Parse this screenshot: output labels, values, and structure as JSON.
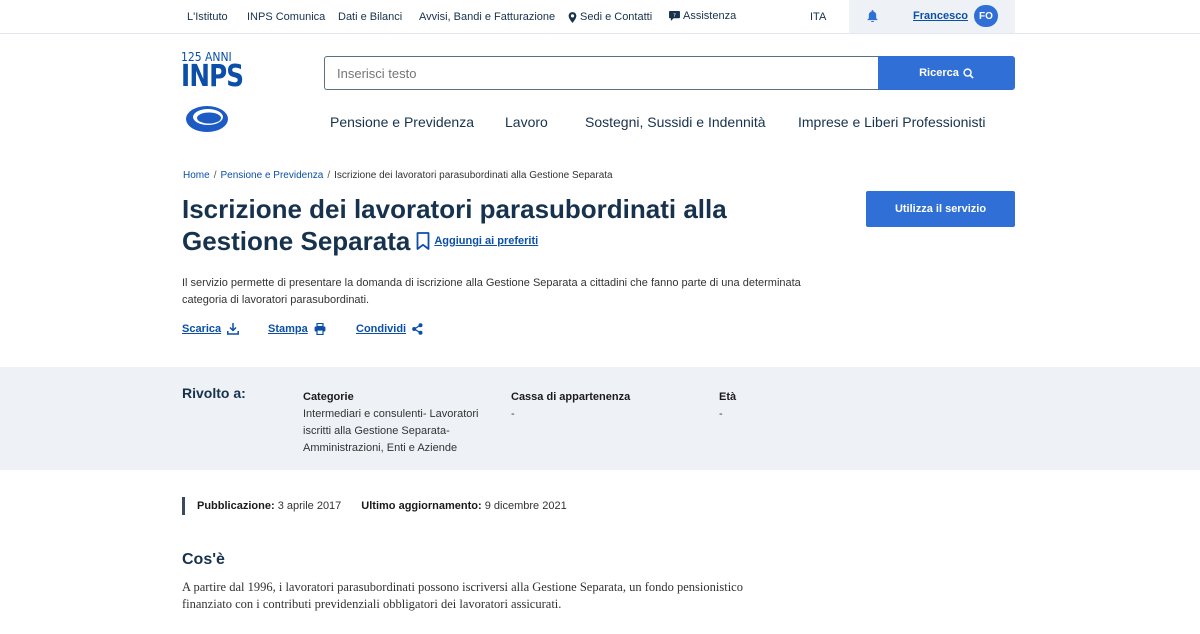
{
  "topbar": {
    "links": [
      "L'Istituto",
      "INPS Comunica",
      "Dati e Bilanci",
      "Avvisi, Bandi e Fatturazione"
    ],
    "sedi": "Sedi e Contatti",
    "assistenza": "Assistenza",
    "language": "ITA",
    "user_name": "Francesco",
    "user_initials": "FO"
  },
  "logo": {
    "top": "125 ANNI",
    "main": "INPS"
  },
  "search": {
    "placeholder": "Inserisci testo",
    "button": "Ricerca"
  },
  "mainnav": [
    "Pensione e Previdenza",
    "Lavoro",
    "Sostegni, Sussidi e Indennità",
    "Imprese e Liberi Professionisti"
  ],
  "breadcrumb": {
    "home": "Home",
    "section": "Pensione e Previdenza",
    "current": "Iscrizione dei lavoratori parasubordinati alla Gestione Separata"
  },
  "page": {
    "title_line1": "Iscrizione dei lavoratori parasubordinati alla",
    "title_line2": "Gestione Separata",
    "favorite": "Aggiungi ai preferiti",
    "use_service": "Utilizza il servizio",
    "description": "Il servizio permette di presentare la domanda di iscrizione alla Gestione Separata a cittadini che fanno parte di una determinata categoria di lavoratori parasubordinati."
  },
  "actions": {
    "download": "Scarica",
    "print": "Stampa",
    "share": "Condividi"
  },
  "rivolto": {
    "label": "Rivolto a:",
    "categorie_head": "Categorie",
    "categorie_value": "Intermediari e consulenti- Lavoratori iscritti alla Gestione Separata- Amministrazioni, Enti e Aziende",
    "cassa_head": "Cassa di appartenenza",
    "cassa_value": "-",
    "eta_head": "Età",
    "eta_value": "-"
  },
  "meta": {
    "pub_label": "Pubblicazione:",
    "pub_date": "3 aprile 2017",
    "upd_label": "Ultimo aggiornamento:",
    "upd_date": "9 dicembre 2021"
  },
  "cose": {
    "title": "Cos'è",
    "text": "A partire dal 1996, i lavoratori parasubordinati possono iscriversi alla Gestione Separata, un fondo pensionistico finanziato con i contributi previdenziali obbligatori dei lavoratori assicurati."
  },
  "colors": {
    "primary": "#2f6fd6",
    "dark_blue": "#17324d",
    "link": "#0b4fa8",
    "band": "#eef2f7"
  },
  "icons": [
    "location-icon",
    "chat-icon",
    "bell-icon",
    "search-icon",
    "bookmark-icon",
    "download-icon",
    "print-icon",
    "share-icon"
  ]
}
